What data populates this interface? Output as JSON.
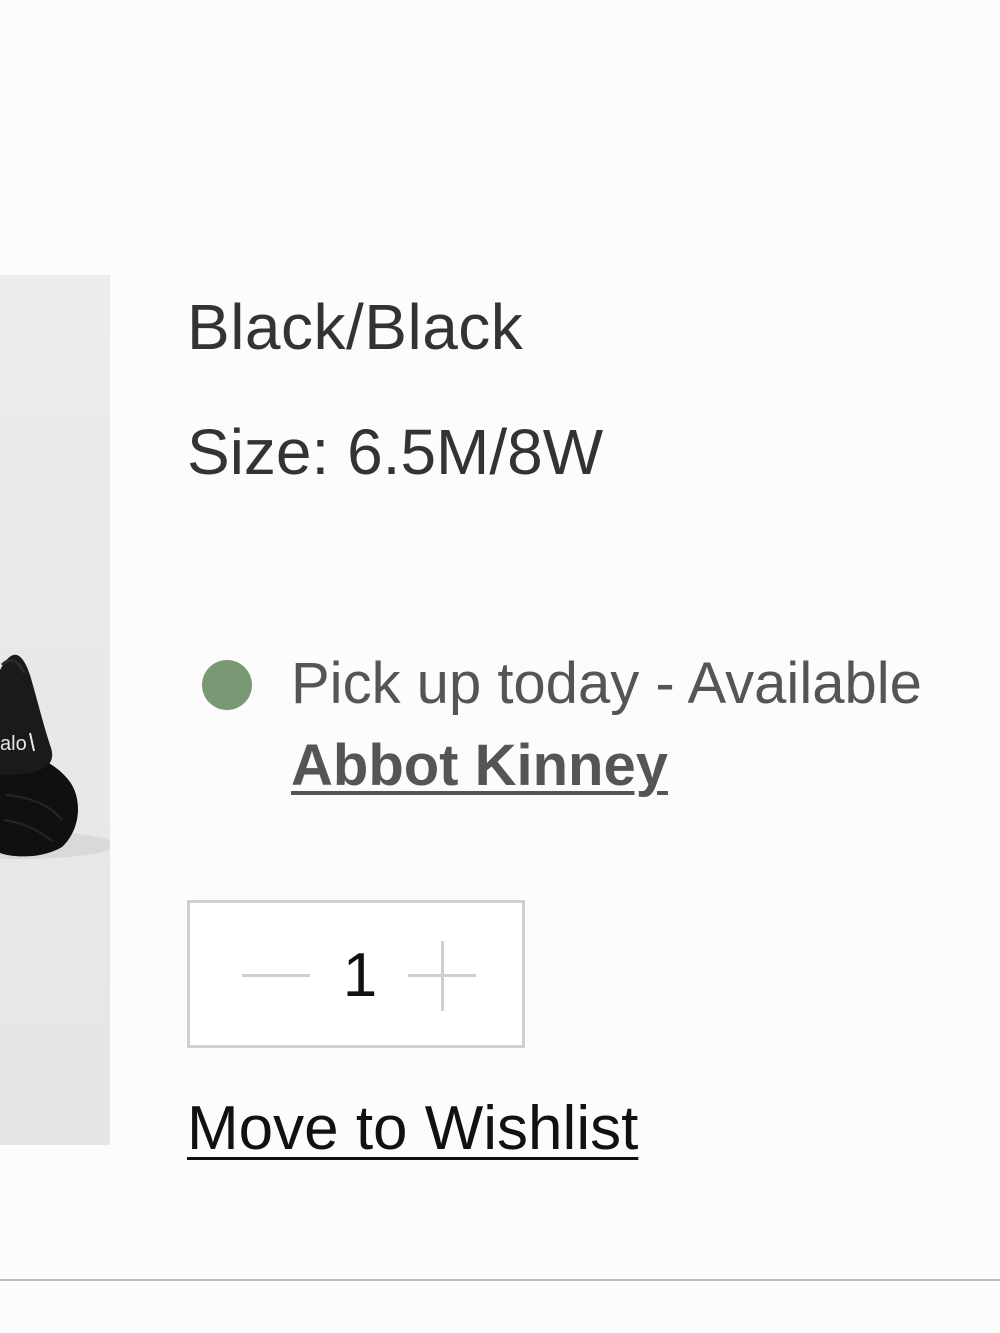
{
  "product": {
    "color": "Black/Black",
    "size_line": "Size: 6.5M/8W",
    "image_logo_text": "alo"
  },
  "pickup": {
    "status_color": "#7a9873",
    "text": "Pick up today - Available",
    "store": "Abbot Kinney"
  },
  "quantity": {
    "value": "1"
  },
  "actions": {
    "wishlist_label": "Move to Wishlist"
  }
}
